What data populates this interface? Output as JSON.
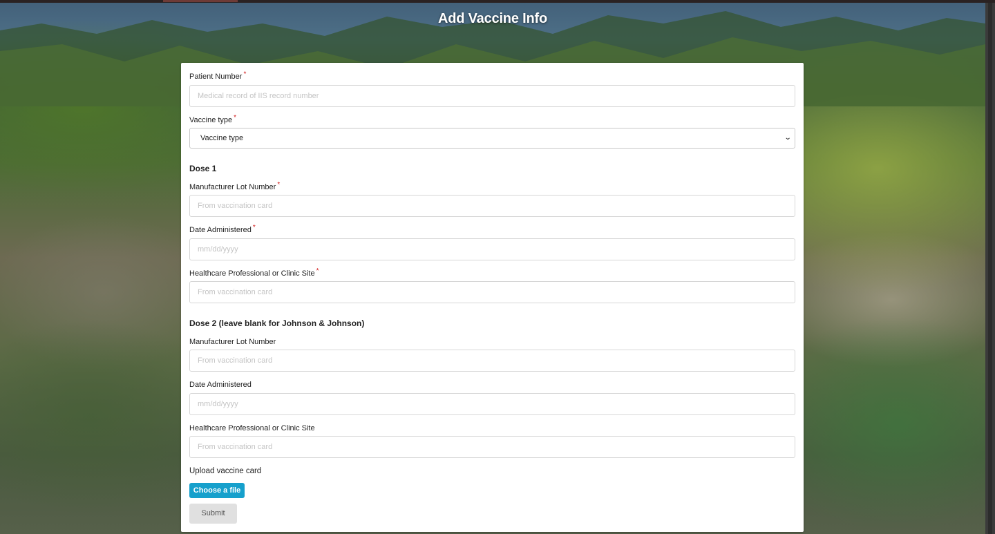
{
  "page": {
    "title": "Add Vaccine Info"
  },
  "form": {
    "patient_number": {
      "label": "Patient Number",
      "required_mark": "*",
      "placeholder": "Medical record of IIS record number",
      "value": ""
    },
    "vaccine_type": {
      "label": "Vaccine type",
      "required_mark": "*",
      "selected": "Vaccine type"
    },
    "dose1": {
      "heading": "Dose 1",
      "lot_number": {
        "label": "Manufacturer Lot Number",
        "required_mark": "*",
        "placeholder": "From vaccination card",
        "value": ""
      },
      "date": {
        "label": "Date Administered",
        "required_mark": "*",
        "placeholder": "mm/dd/yyyy",
        "value": ""
      },
      "site": {
        "label": "Healthcare Professional or Clinic Site",
        "required_mark": "*",
        "placeholder": "From vaccination card",
        "value": ""
      }
    },
    "dose2": {
      "heading": "Dose 2 (leave blank for Johnson & Johnson)",
      "lot_number": {
        "label": "Manufacturer Lot Number",
        "placeholder": "From vaccination card",
        "value": ""
      },
      "date": {
        "label": "Date Administered",
        "placeholder": "mm/dd/yyyy",
        "value": ""
      },
      "site": {
        "label": "Healthcare Professional or Clinic Site",
        "placeholder": "From vaccination card",
        "value": ""
      }
    },
    "upload": {
      "label": "Upload vaccine card",
      "button_label": "Choose a file"
    },
    "submit_label": "Submit"
  },
  "icons": {
    "select_chevron": "chevron-down-icon"
  },
  "colors": {
    "file_button": "#16a0cc",
    "submit_button": "#e0e0e0",
    "required_mark": "#d21a1a"
  }
}
